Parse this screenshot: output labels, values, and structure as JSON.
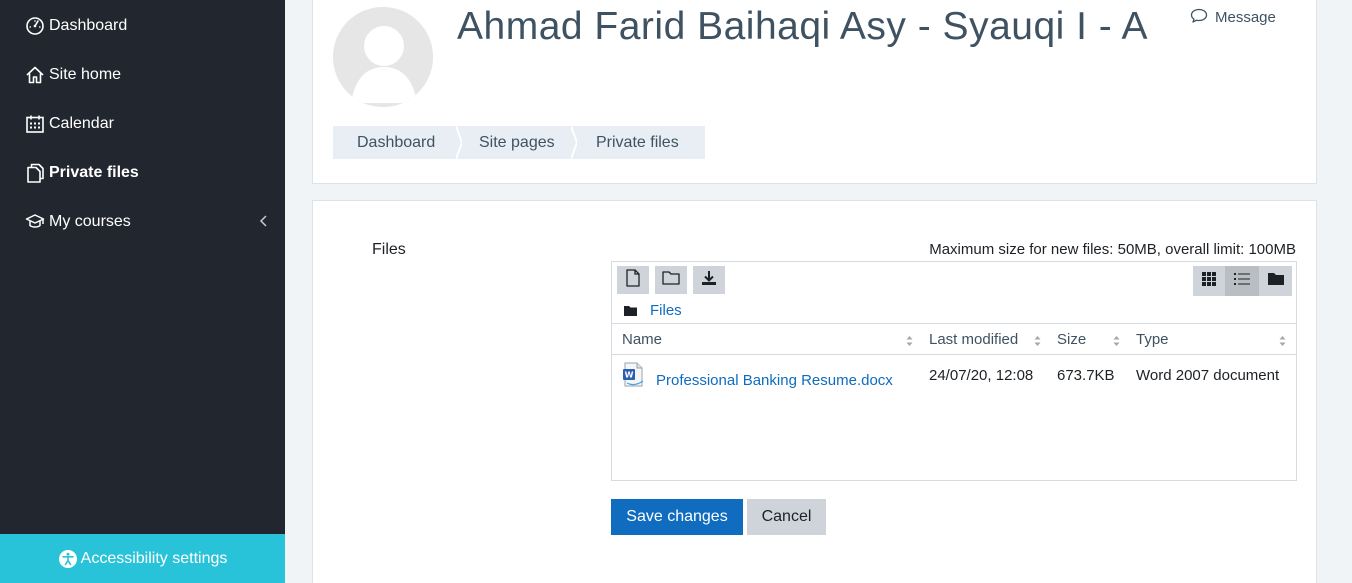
{
  "sidebar": {
    "items": [
      {
        "label": "Dashboard",
        "icon": "dashboard-gauge-icon"
      },
      {
        "label": "Site home",
        "icon": "home-icon"
      },
      {
        "label": "Calendar",
        "icon": "calendar-icon"
      },
      {
        "label": "Private files",
        "icon": "files-icon",
        "active": true
      },
      {
        "label": "My courses",
        "icon": "graduation-cap-icon",
        "expandable": true
      }
    ],
    "accessibility_label": "Accessibility settings"
  },
  "header": {
    "title": "Ahmad Farid Baihaqi Asy - Syauqi I - A",
    "message_label": "Message",
    "breadcrumb": [
      "Dashboard",
      "Site pages",
      "Private files"
    ]
  },
  "files_form": {
    "label": "Files",
    "limit_text": "Maximum size for new files: 50MB, overall limit: 100MB",
    "path_label": "Files",
    "columns": [
      "Name",
      "Last modified",
      "Size",
      "Type"
    ],
    "rows": [
      {
        "name": "Professional Banking Resume.docx",
        "modified": "24/07/20, 12:08",
        "size": "673.7KB",
        "type": "Word 2007 document",
        "icon": "word-document-icon"
      }
    ],
    "view_mode": "list",
    "save_label": "Save changes",
    "cancel_label": "Cancel"
  },
  "colors": {
    "sidebar_bg": "#22262e",
    "accessibility_bg": "#29c3d9",
    "primary": "#0f6cbf",
    "link": "#0f6cbf",
    "title": "#3f5262"
  }
}
